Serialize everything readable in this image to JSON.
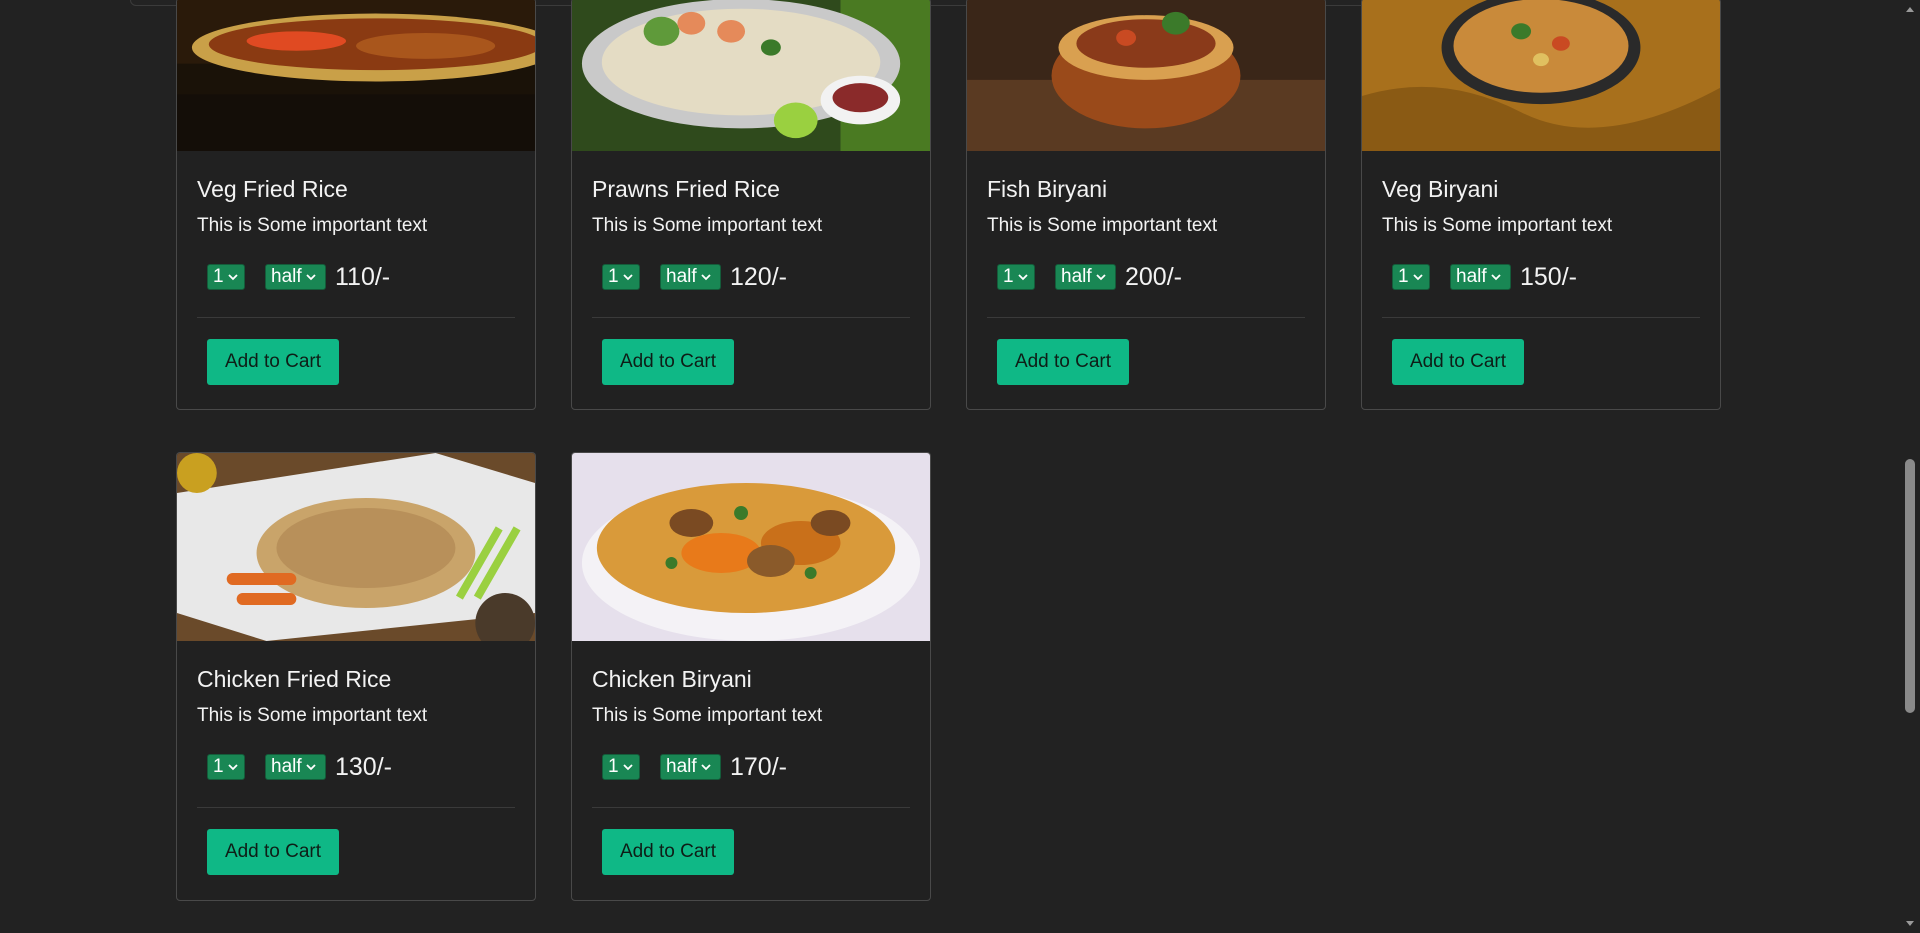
{
  "colors": {
    "background": "#222222",
    "card_border": "#3d3d3d",
    "select_green": "#198754",
    "button_green": "#0fb886"
  },
  "cards": [
    {
      "title": "Veg Fried Rice",
      "text": "This is Some important text",
      "qty": "1",
      "size": "half",
      "price": "110/-",
      "button": "Add to Cart",
      "icon": "chevron-down-icon"
    },
    {
      "title": "Prawns Fried Rice",
      "text": "This is Some important text",
      "qty": "1",
      "size": "half",
      "price": "120/-",
      "button": "Add to Cart",
      "icon": "chevron-down-icon"
    },
    {
      "title": "Fish Biryani",
      "text": "This is Some important text",
      "qty": "1",
      "size": "half",
      "price": "200/-",
      "button": "Add to Cart",
      "icon": "chevron-down-icon"
    },
    {
      "title": "Veg Biryani",
      "text": "This is Some important text",
      "qty": "1",
      "size": "half",
      "price": "150/-",
      "button": "Add to Cart",
      "icon": "chevron-down-icon"
    },
    {
      "title": "Chicken Fried Rice",
      "text": "This is Some important text",
      "qty": "1",
      "size": "half",
      "price": "130/-",
      "button": "Add to Cart",
      "icon": "chevron-down-icon"
    },
    {
      "title": "Chicken Biryani",
      "text": "This is Some important text",
      "qty": "1",
      "size": "half",
      "price": "170/-",
      "button": "Add to Cart",
      "icon": "chevron-down-icon"
    }
  ]
}
